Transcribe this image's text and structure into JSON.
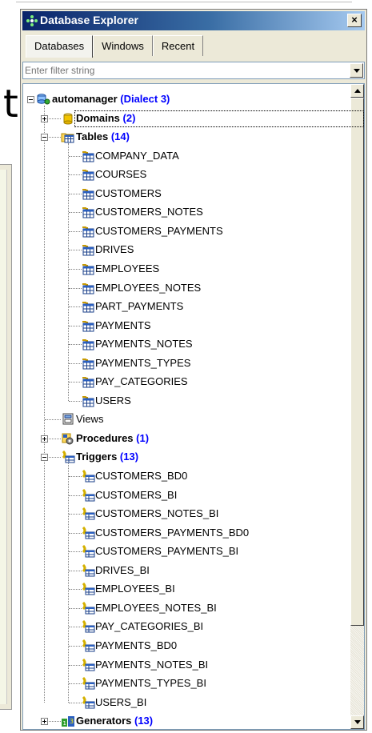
{
  "panel": {
    "title": "Database Explorer",
    "close_label": "×",
    "tabs": [
      {
        "label": "Databases",
        "active": true
      },
      {
        "label": "Windows",
        "active": false
      },
      {
        "label": "Recent",
        "active": false
      }
    ],
    "filter": {
      "placeholder": "Enter filter string",
      "value": ""
    }
  },
  "background": {
    "letter": "t"
  },
  "tree": {
    "root": {
      "name": "automanager",
      "note": "(Dialect 3)"
    },
    "domains": {
      "name": "Domains",
      "count": "(2)"
    },
    "tables": {
      "name": "Tables",
      "count": "(14)",
      "items": [
        "COMPANY_DATA",
        "COURSES",
        "CUSTOMERS",
        "CUSTOMERS_NOTES",
        "CUSTOMERS_PAYMENTS",
        "DRIVES",
        "EMPLOYEES",
        "EMPLOYEES_NOTES",
        "PART_PAYMENTS",
        "PAYMENTS",
        "PAYMENTS_NOTES",
        "PAYMENTS_TYPES",
        "PAY_CATEGORIES",
        "USERS"
      ]
    },
    "views": {
      "name": "Views"
    },
    "procedures": {
      "name": "Procedures",
      "count": "(1)"
    },
    "triggers": {
      "name": "Triggers",
      "count": "(13)",
      "items": [
        "CUSTOMERS_BD0",
        "CUSTOMERS_BI",
        "CUSTOMERS_NOTES_BI",
        "CUSTOMERS_PAYMENTS_BD0",
        "CUSTOMERS_PAYMENTS_BI",
        "DRIVES_BI",
        "EMPLOYEES_BI",
        "EMPLOYEES_NOTES_BI",
        "PAY_CATEGORIES_BI",
        "PAYMENTS_BD0",
        "PAYMENTS_NOTES_BI",
        "PAYMENTS_TYPES_BI",
        "USERS_BI"
      ]
    },
    "generators": {
      "name": "Generators",
      "count": "(13)"
    }
  },
  "colors": {
    "title_bar": "#0a246a",
    "count_text": "#0000ff",
    "panel_bg": "#ece9d8"
  }
}
